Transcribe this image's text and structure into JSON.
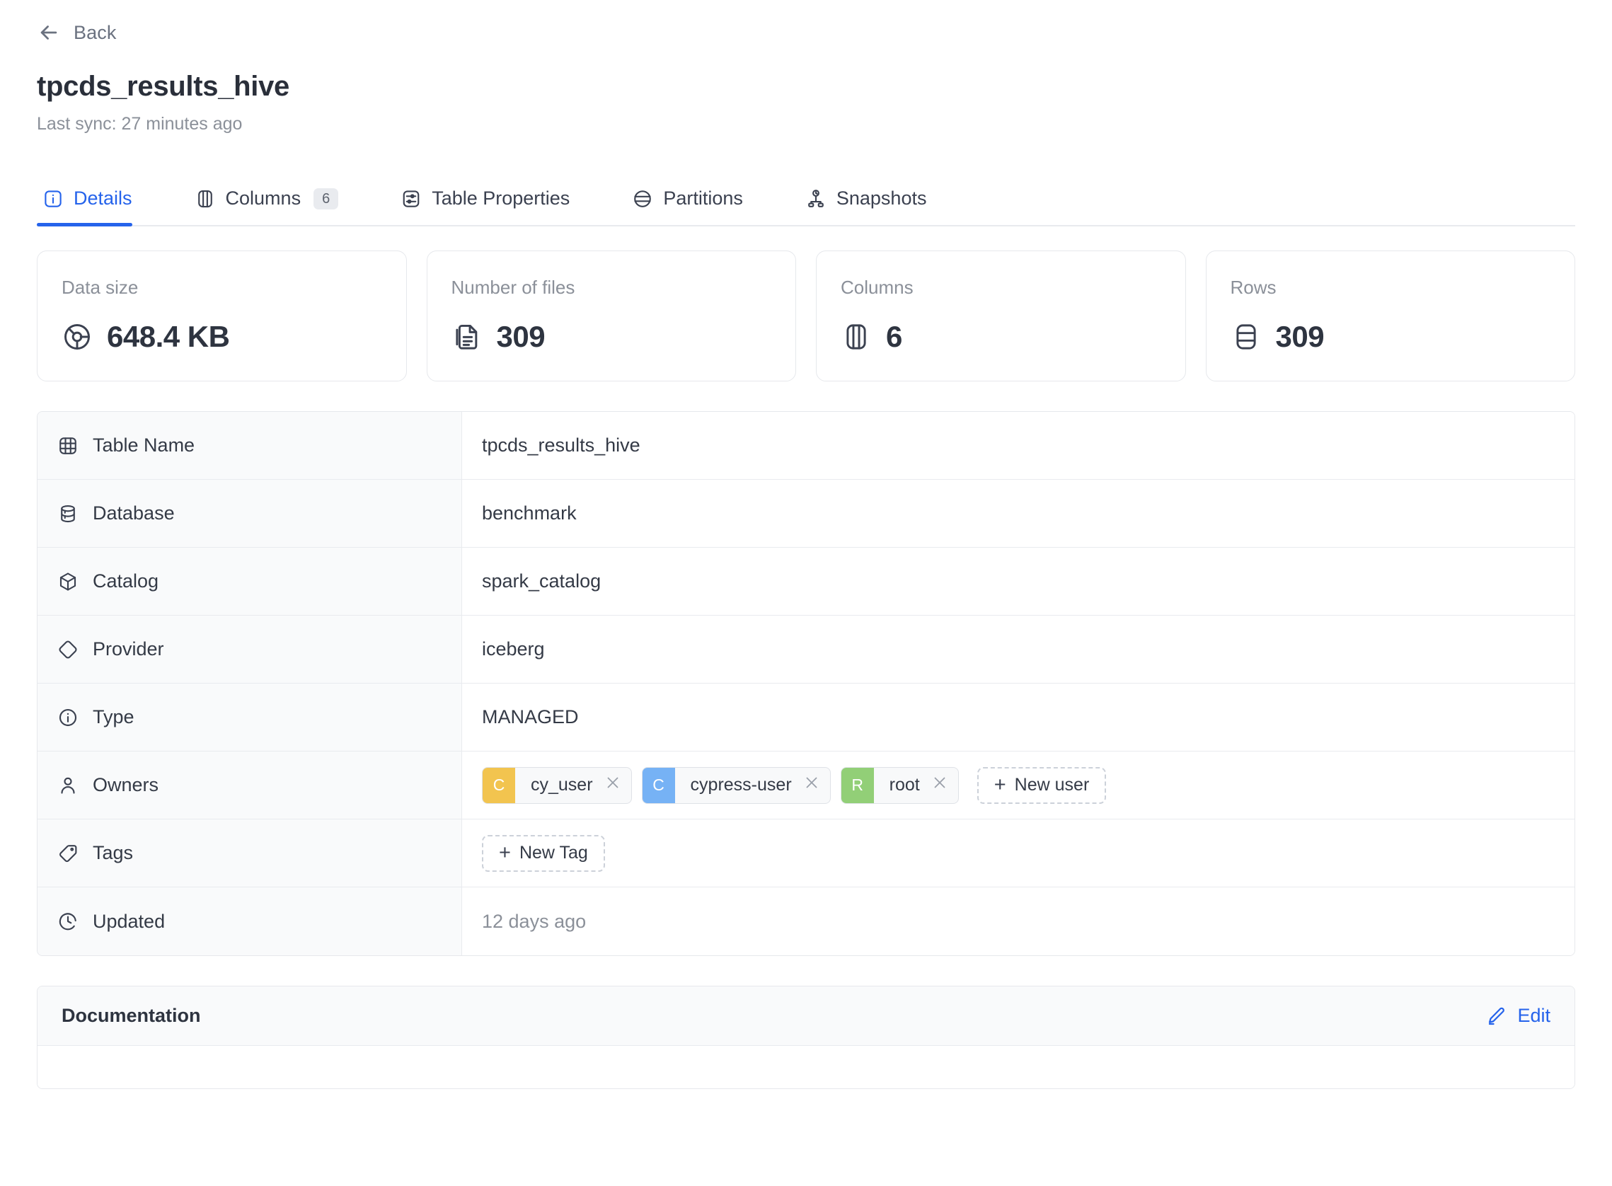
{
  "header": {
    "back_label": "Back",
    "back_icon": "arrow-left-icon",
    "title": "tpcds_results_hive",
    "subtitle": "Last sync: 27 minutes ago"
  },
  "tabs": [
    {
      "label": "Details",
      "icon": "info-square-icon",
      "active": true,
      "badge": null
    },
    {
      "label": "Columns",
      "icon": "columns-icon",
      "active": false,
      "badge": "6"
    },
    {
      "label": "Table Properties",
      "icon": "sliders-square-icon",
      "active": false,
      "badge": null
    },
    {
      "label": "Partitions",
      "icon": "partitions-circle-icon",
      "active": false,
      "badge": null
    },
    {
      "label": "Snapshots",
      "icon": "snapshot-history-icon",
      "active": false,
      "badge": null
    }
  ],
  "stat_cards": [
    {
      "label": "Data size",
      "value": "648.4 KB",
      "icon": "disc-chart-icon"
    },
    {
      "label": "Number of files",
      "value": "309",
      "icon": "file-lines-icon"
    },
    {
      "label": "Columns",
      "value": "6",
      "icon": "columns-icon"
    },
    {
      "label": "Rows",
      "value": "309",
      "icon": "rows-icon"
    }
  ],
  "details": [
    {
      "label": "Table Name",
      "icon": "table-grid-icon",
      "value": "tpcds_results_hive",
      "type": "text"
    },
    {
      "label": "Database",
      "icon": "database-icon",
      "value": "benchmark",
      "type": "text"
    },
    {
      "label": "Catalog",
      "icon": "cube-icon",
      "value": "spark_catalog",
      "type": "text"
    },
    {
      "label": "Provider",
      "icon": "diamond-icon",
      "value": "iceberg",
      "type": "text"
    },
    {
      "label": "Type",
      "icon": "info-circle-icon",
      "value": "MANAGED",
      "type": "text"
    },
    {
      "label": "Owners",
      "icon": "user-icon",
      "value": null,
      "type": "owners"
    },
    {
      "label": "Tags",
      "icon": "tag-icon",
      "value": null,
      "type": "tags"
    },
    {
      "label": "Updated",
      "icon": "clock-icon",
      "value": "12 days ago",
      "type": "muted-text"
    }
  ],
  "owners": [
    {
      "name": "cy_user",
      "initial": "C",
      "color": "#f2c44f",
      "remove_icon": "close-icon"
    },
    {
      "name": "cypress-user",
      "initial": "C",
      "color": "#76b2f5",
      "remove_icon": "close-icon"
    },
    {
      "name": "root",
      "initial": "R",
      "color": "#92cf77",
      "remove_icon": "close-icon"
    }
  ],
  "buttons": {
    "new_user": "New user",
    "new_tag": "New Tag",
    "plus_glyph": "+"
  },
  "documentation": {
    "title": "Documentation",
    "edit_label": "Edit",
    "edit_icon": "pencil-icon"
  },
  "colors": {
    "accent": "#2563eb",
    "text": "#343a46",
    "muted": "#8b9099",
    "border": "#e6e8ec",
    "label_bg": "#f9fafb"
  }
}
